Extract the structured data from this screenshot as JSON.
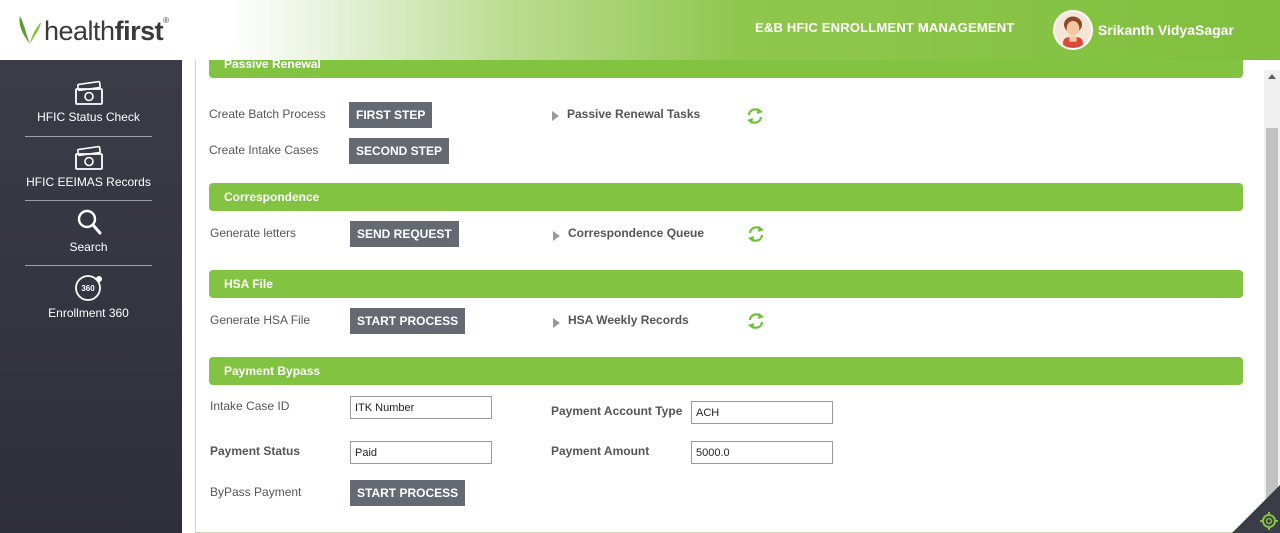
{
  "header": {
    "logo": {
      "part1": "health",
      "part2": "first",
      "tm": "®"
    },
    "app_title": "E&B HFIC ENROLLMENT MANAGEMENT",
    "user_name": "Srikanth VidyaSagar"
  },
  "sidebar": {
    "items": [
      {
        "label": "HFIC Status Check",
        "icon": "money-icon"
      },
      {
        "label": "HFIC EEIMAS Records",
        "icon": "money-icon"
      },
      {
        "label": "Search",
        "icon": "search-icon"
      },
      {
        "label": "Enrollment 360",
        "icon": "enrollment-360-icon",
        "icon_text": "360"
      }
    ]
  },
  "sections": {
    "passive_renewal": {
      "title": "Passive Renewal",
      "row1_label": "Create Batch Process",
      "row1_button": "FIRST STEP",
      "row2_label": "Create Intake Cases",
      "row2_button": "SECOND STEP",
      "tasks_label": "Passive Renewal Tasks"
    },
    "correspondence": {
      "title": "Correspondence",
      "row_label": "Generate letters",
      "row_button": "SEND REQUEST",
      "queue_label": "Correspondence Queue"
    },
    "hsa_file": {
      "title": "HSA File",
      "row_label": "Generate HSA File",
      "row_button": "START PROCESS",
      "records_label": "HSA Weekly Records"
    },
    "payment_bypass": {
      "title": "Payment Bypass",
      "intake_case_label": "Intake Case ID",
      "intake_case_value": "ITK Number",
      "account_type_label": "Payment Account Type",
      "account_type_value": "ACH",
      "status_label": "Payment Status",
      "status_value": "Paid",
      "amount_label": "Payment Amount",
      "amount_value": "5000.0",
      "bypass_label": "ByPass Payment",
      "bypass_button": "START PROCESS"
    }
  },
  "colors": {
    "accent_green": "#82c341",
    "sidebar_bg": "#34353f",
    "button_gray": "#656a72"
  }
}
